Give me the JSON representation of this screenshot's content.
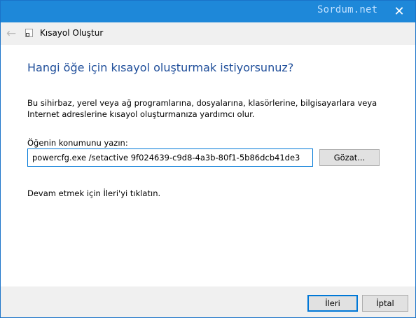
{
  "window": {
    "title": "Kısayol Oluştur",
    "watermark": "Sordum.net",
    "close_glyph": "✕",
    "back_glyph": "←"
  },
  "page": {
    "heading": "Hangi öğe için kısayol oluşturmak istiyorsunuz?",
    "description": "Bu sihirbaz, yerel veya ağ programlarına, dosyalarına, klasörlerine, bilgisayarlara veya Internet adreslerine kısayol oluşturmanıza yardımcı olur.",
    "location_label": "Öğenin konumunu yazın:",
    "location_value": "powercfg.exe /setactive 9f024639-c9d8-4a3b-80f1-5b86dcb41de3",
    "browse_label": "Gözat...",
    "hint": "Devam etmek için İleri'yi tıklatın."
  },
  "footer": {
    "next_label": "İleri",
    "cancel_label": "İptal"
  },
  "colors": {
    "titlebar": "#1e88d9",
    "heading": "#1f4e9a",
    "focus_border": "#0078d7"
  },
  "icons": [
    "back-arrow-icon",
    "shortcut-icon",
    "close-icon"
  ]
}
